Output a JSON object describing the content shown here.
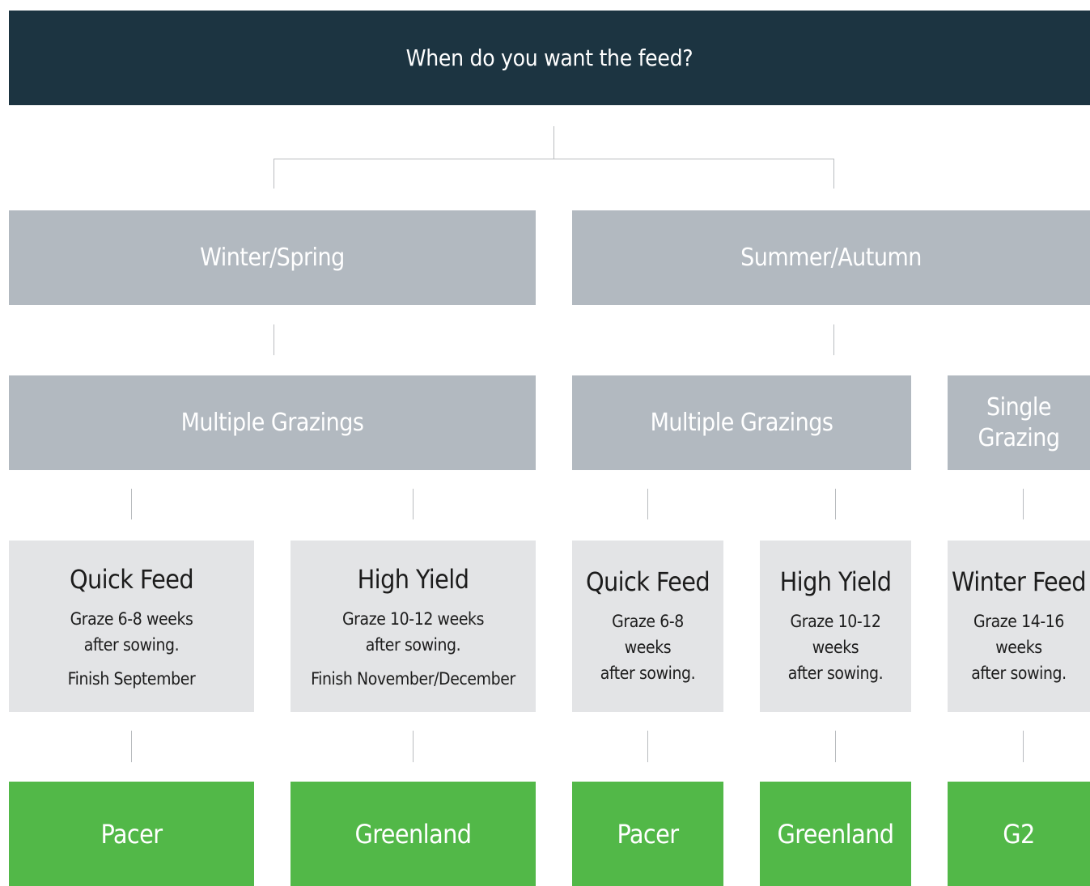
{
  "root": {
    "label": "When do you want the feed?"
  },
  "seasons": [
    {
      "label": "Winter/Spring"
    },
    {
      "label": "Summer/Autumn"
    }
  ],
  "grazings": [
    {
      "label": "Multiple Grazings"
    },
    {
      "label": "Multiple Grazings"
    },
    {
      "label": "Single\nGrazing"
    }
  ],
  "options": [
    {
      "title": "Quick Feed",
      "desc": "Graze 6-8 weeks\nafter sowing.",
      "finish": "Finish September"
    },
    {
      "title": "High Yield",
      "desc": "Graze 10-12 weeks\nafter sowing.",
      "finish": "Finish November/December"
    },
    {
      "title": "Quick Feed",
      "desc": "Graze 6-8\nweeks\nafter sowing.",
      "finish": ""
    },
    {
      "title": "High Yield",
      "desc": "Graze 10-12\nweeks\nafter sowing.",
      "finish": ""
    },
    {
      "title": "Winter Feed",
      "desc": "Graze 14-16\nweeks\nafter sowing.",
      "finish": ""
    }
  ],
  "products": [
    {
      "label": "Pacer"
    },
    {
      "label": "Greenland"
    },
    {
      "label": "Pacer"
    },
    {
      "label": "Greenland"
    },
    {
      "label": "G2"
    }
  ],
  "colors": {
    "root_bg": "#1c3441",
    "node_bg": "#b2b9c0",
    "option_bg": "#e3e4e6",
    "product_bg": "#52b848",
    "connector": "#b9bcbf"
  }
}
